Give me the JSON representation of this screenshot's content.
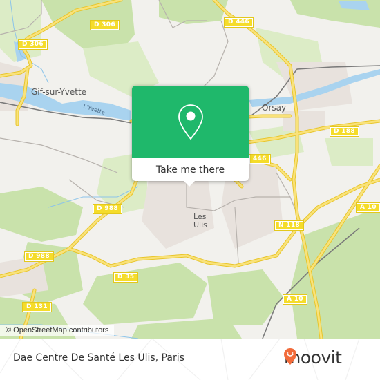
{
  "map": {
    "places": {
      "gif": "Gif-sur-Yvette",
      "orsay": "Orsay",
      "les_ulis_line1": "Les",
      "les_ulis_line2": "Ulis"
    },
    "river": "L'Yvette",
    "road_labels": {
      "d306_a": "D 306",
      "d306_b": "D 306",
      "d446_a": "D 446",
      "d446_b": "446",
      "d188": "D 188",
      "d988_a": "D 988",
      "d988_b": "D 988",
      "n118": "N 118",
      "a10_a": "A 10",
      "a10_b": "A 10",
      "d35": "D 35",
      "d131": "D 131"
    },
    "attribution": "© OpenStreetMap contributors",
    "colors": {
      "popup_green": "#1fb86b",
      "road_yellow": "#f5dc2a",
      "forest_green": "#c8e0a8",
      "water_blue": "#a9d3ef"
    }
  },
  "popup": {
    "icon": "location-pin-icon",
    "button_label": "Take me there"
  },
  "footer": {
    "title": "Dae Centre De Santé Les Ulis, Paris",
    "brand": "moovit",
    "brand_icon": "moovit-smiley-pin-icon",
    "brand_color": "#f26b3a"
  }
}
